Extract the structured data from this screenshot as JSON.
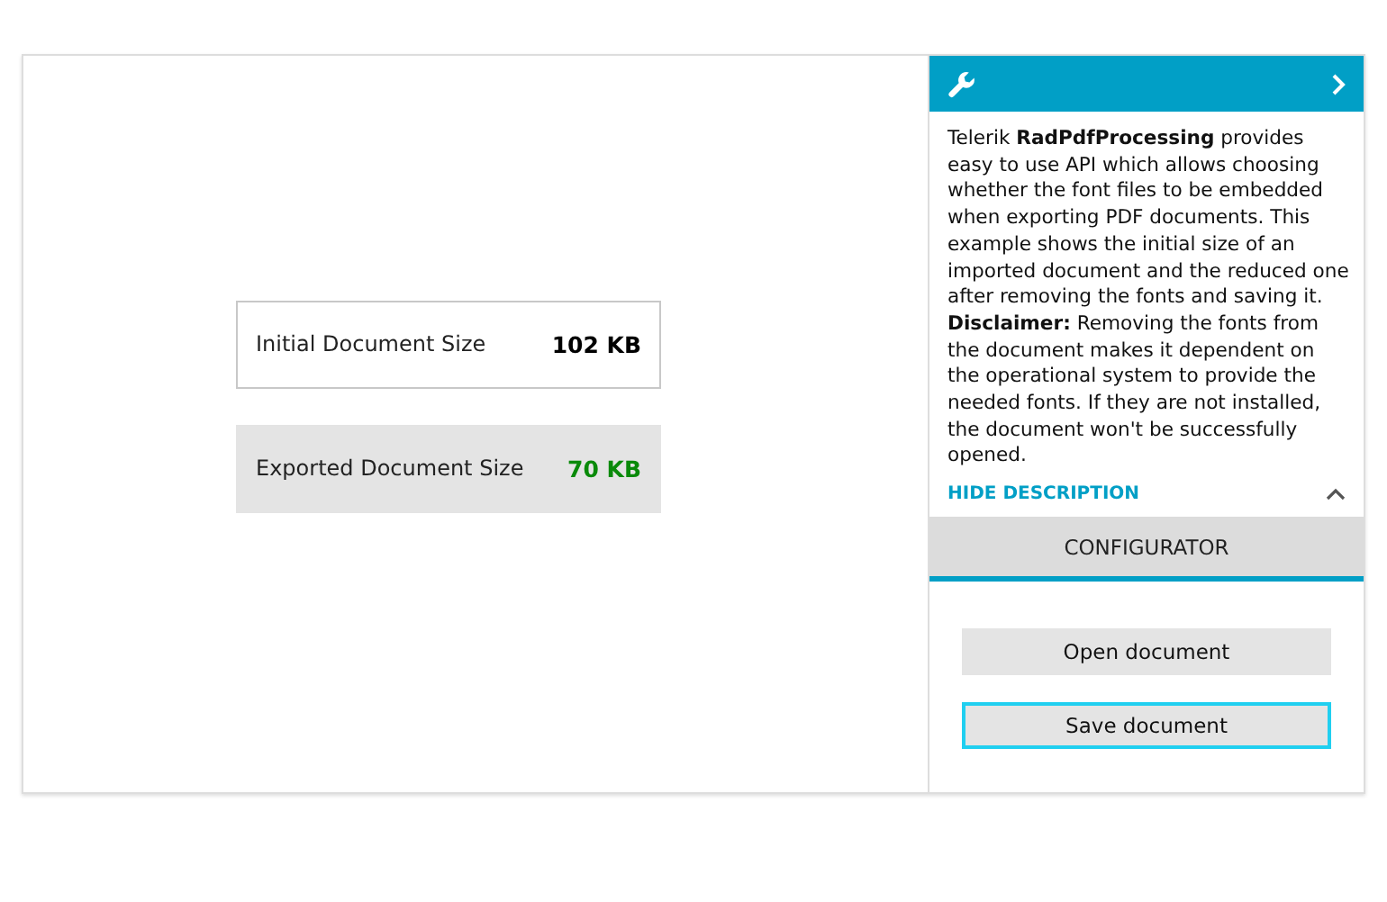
{
  "sizes": [
    {
      "kind": "plain",
      "label": "Initial Document Size",
      "value": "102 KB"
    },
    {
      "kind": "shaded",
      "label": "Exported Document Size",
      "value": "70 KB"
    }
  ],
  "panel": {
    "description": "Telerik **RadPdfProcessing** provides easy to use API which allows choosing whether the font files to be embedded when exporting PDF documents. This example shows the initial size of an imported document and the reduced one after removing the fonts and saving it. **Disclaimer:** Removing the fonts from the document makes it dependent on the operational system to provide the needed fonts. If they are not installed, the document won't be successfully opened.",
    "toggle": "HIDE DESCRIPTION",
    "expanded": true,
    "tabs": [
      {
        "label": "CONFIGURATOR",
        "selected": true
      }
    ],
    "buttons": [
      {
        "label": "Open document",
        "focused": false
      },
      {
        "label": "Save document",
        "focused": true
      }
    ]
  }
}
